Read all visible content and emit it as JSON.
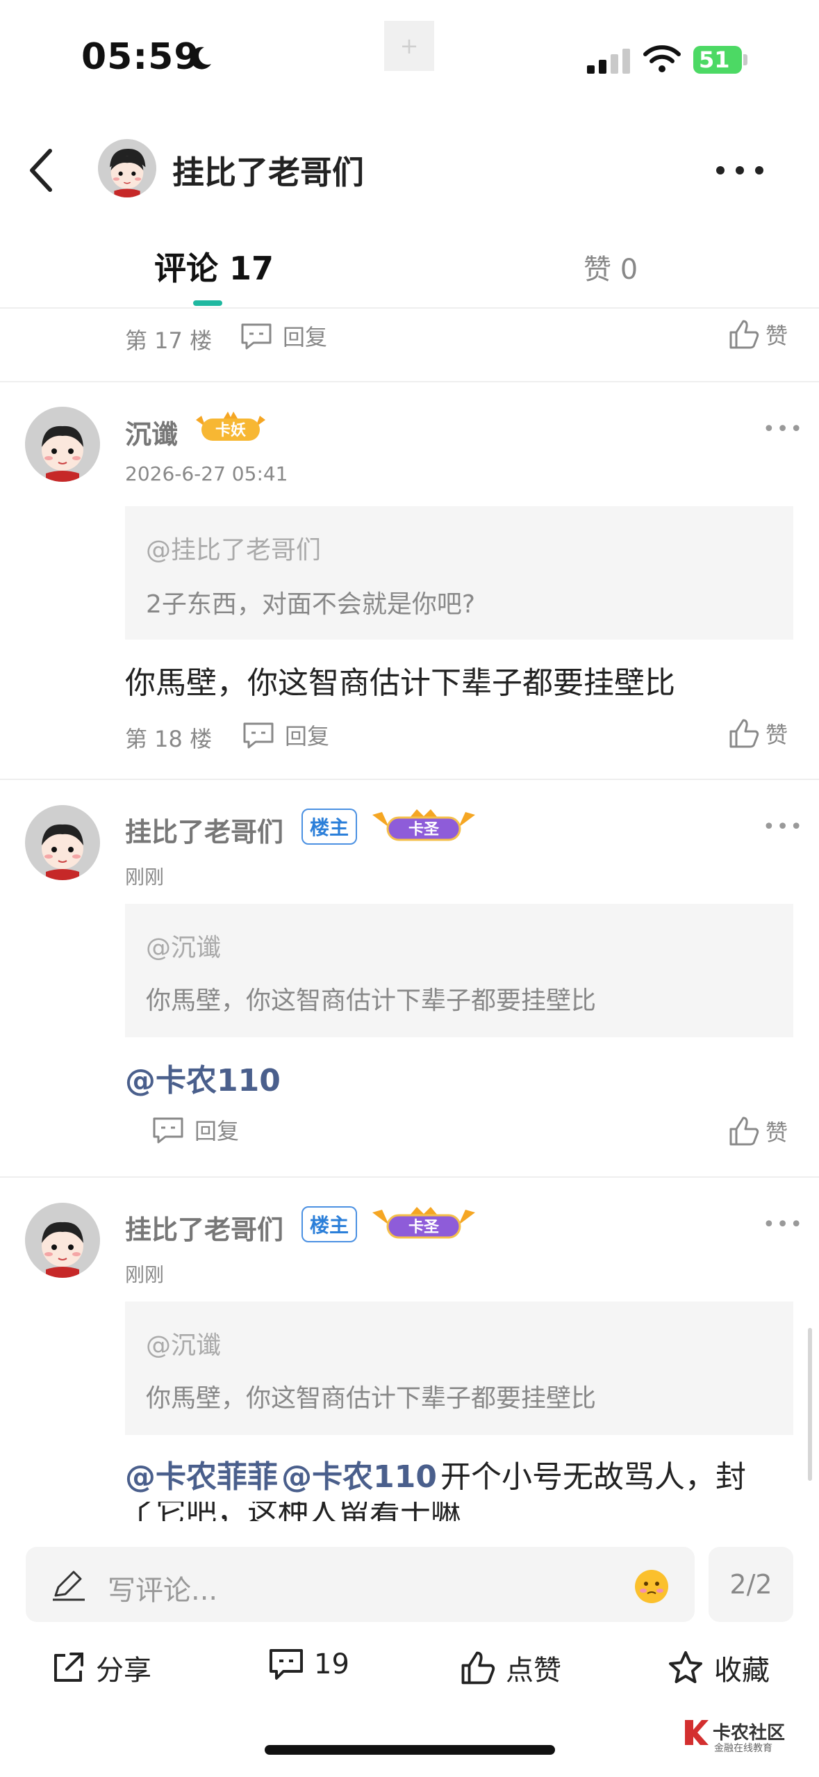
{
  "status_bar": {
    "time": "05:59",
    "battery": "51"
  },
  "header": {
    "title": "挂比了老哥们"
  },
  "tabs": {
    "comments": "评论 17",
    "likes": "赞 0"
  },
  "partial_item": {
    "floor": "第 17 楼",
    "reply": "回复",
    "like": "赞"
  },
  "comments": [
    {
      "username": "沉谶",
      "level_badge": "卡妖",
      "time": "2026-6-27 05:41",
      "quote_at": "@挂比了老哥们",
      "quote_text": "2子东西，对面不会就是你吧?",
      "content": "你馬壁，你这智商估计下辈子都要挂壁比",
      "floor": "第 18 楼",
      "reply": "回复",
      "like": "赞"
    },
    {
      "username": "挂比了老哥们",
      "owner_badge": "楼主",
      "level_badge": "卡圣",
      "time": "刚刚",
      "quote_at": "@沉谶",
      "quote_text": "你馬壁，你这智商估计下辈子都要挂壁比",
      "mention": "@卡农110",
      "reply": "回复",
      "like": "赞"
    },
    {
      "username": "挂比了老哥们",
      "owner_badge": "楼主",
      "level_badge": "卡圣",
      "time": "刚刚",
      "quote_at": "@沉谶",
      "quote_text": "你馬壁，你这智商估计下辈子都要挂壁比",
      "mention1": "@卡农菲菲",
      "mention2": "@卡农110",
      "content": "开个小号无故骂人，封",
      "content_line2": "了它吧，这种人留着干嘛"
    }
  ],
  "input": {
    "placeholder": "写评论...",
    "page": "2/2"
  },
  "actions": {
    "share": "分享",
    "comments": "19",
    "like": "点赞",
    "favorite": "收藏"
  },
  "watermark": {
    "name": "卡农社区",
    "sub": "金融在线教育"
  },
  "colors": {
    "accent": "#1fb8a0",
    "mention": "#4a5f8c",
    "owner_badge": "#2b7fd9"
  }
}
